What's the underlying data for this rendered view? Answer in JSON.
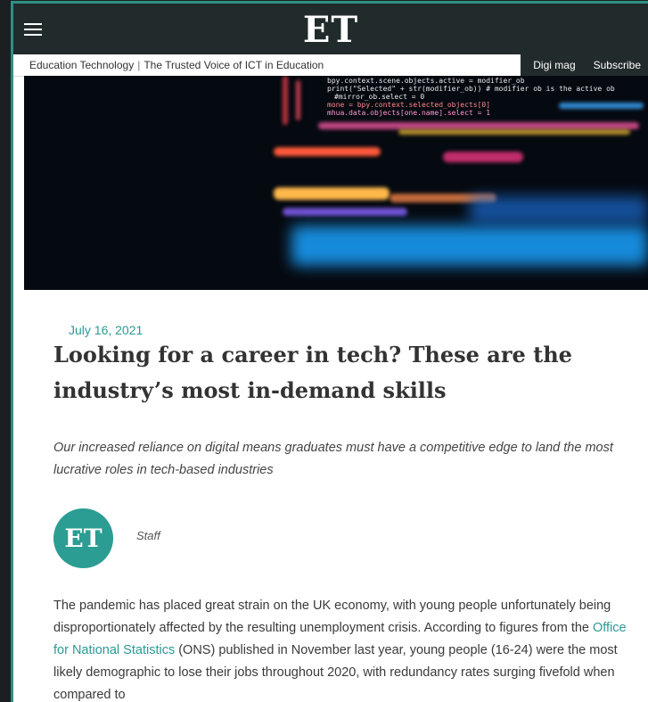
{
  "header": {
    "logo": "ET",
    "tagline_site": "Education Technology",
    "tagline_separator": "|",
    "tagline_text": "The Trusted Voice of ICT in Education",
    "digi_mag": "Digi mag",
    "subscribe": "Subscribe"
  },
  "hero": {
    "code_lines": [
      "bpy.context.scene.objects.active = modifier_ob",
      "print(\"Selected\" + str(modifier_ob)) # modifier ob is the active ob",
      "   #mirror_ob.select = 0",
      "mone = bpy.context.selected_objects[0]",
      "mhua.data.objects[one.name].select = 1"
    ]
  },
  "article": {
    "date": "July 16, 2021",
    "title": "Looking for a career in tech? These are the industry’s most in-demand skills",
    "lede": "Our increased reliance on digital means graduates must have a competitive edge to land the most lucrative roles in tech-based industries",
    "author_avatar": "ET",
    "author": "Staff",
    "body_part1": "The pandemic has placed great strain on the UK economy, with young people unfortunately being disproportionately affected by the resulting unemployment crisis. According to figures from the ",
    "body_link": "Office for National Statistics",
    "body_part2": " (ONS) published in November last year, young people (16-24) were the most likely demographic to lose their jobs throughout 2020, with redundancy rates surging fivefold when compared to"
  },
  "colors": {
    "accent": "#2a9a95",
    "header_bg": "#222b2c",
    "frame_border": "#2f8f86"
  }
}
